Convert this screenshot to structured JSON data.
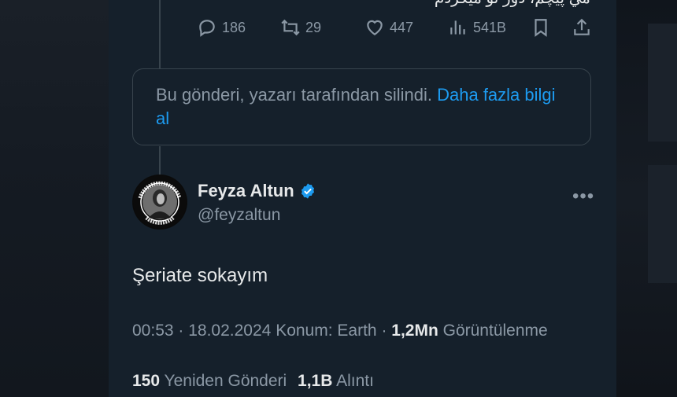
{
  "top_tweet": {
    "cut_text": "مي پيچم، دور تو ميگردم",
    "actions": {
      "replies": "186",
      "reposts": "29",
      "likes": "447",
      "views": "541B"
    }
  },
  "deleted_notice": {
    "text": "Bu gönderi, yazarı tarafından silindi.",
    "link": "Daha fazla bilgi al"
  },
  "author": {
    "name": "Feyza Altun",
    "handle": "@feyzaltun",
    "verified": true,
    "avatar_lettering_top": "YASALARA DOKUNMA",
    "avatar_lettering_bottom": "UYGULA"
  },
  "tweet": {
    "text": "Şeriate sokayım",
    "time": "00:53",
    "date": "18.02.2024",
    "location": "Konum: Earth",
    "views_count": "1,2Mn",
    "views_label": "Görüntülenme"
  },
  "stats": {
    "reposts_count": "150",
    "reposts_label": "Yeniden Gönderi",
    "quotes_count": "1,1B",
    "quotes_label": "Alıntı"
  },
  "colors": {
    "background": "#15202b",
    "primary_text": "#e7e9ea",
    "secondary_text": "#8b98a5",
    "accent": "#1d9bf0",
    "border": "#38444d"
  }
}
